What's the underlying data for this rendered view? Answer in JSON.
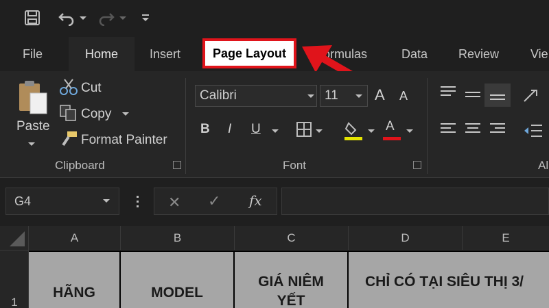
{
  "quick_access": {
    "icons": [
      "save-icon",
      "undo-icon",
      "redo-icon",
      "customize-icon"
    ]
  },
  "tabs": [
    {
      "label": "File"
    },
    {
      "label": "Home"
    },
    {
      "label": "Insert"
    },
    {
      "label": "Page Layout"
    },
    {
      "label": "Formulas"
    },
    {
      "label": "Data"
    },
    {
      "label": "Review"
    },
    {
      "label": "Vie"
    }
  ],
  "clipboard": {
    "paste_label": "Paste",
    "cut_label": "Cut",
    "copy_label": "Copy",
    "format_painter_label": "Format Painter",
    "group_label": "Clipboard"
  },
  "font": {
    "font_name": "Calibri",
    "font_size": "11",
    "grow_label": "A",
    "shrink_label": "A",
    "bold_label": "B",
    "italic_label": "I",
    "underline_label": "U",
    "font_color_label": "A",
    "group_label": "Font",
    "fill_color": "#e5e500",
    "font_color": "#e0141b"
  },
  "alignment": {
    "group_label_partial": "Al"
  },
  "formula_bar": {
    "name_box": "G4",
    "fx_label": "fx"
  },
  "grid": {
    "columns": [
      "A",
      "B",
      "C",
      "D",
      "E"
    ],
    "rows": [
      "1"
    ],
    "cells": [
      "HÃNG",
      "MODEL",
      "GIÁ NIÊM YẾT",
      "CHỈ CÓ TẠI SIÊU THỊ 3/"
    ]
  },
  "colors": {
    "highlight": "#e0141b",
    "background": "#1f1f1f",
    "ribbon": "#262626",
    "header_cell": "#a6a6a6"
  }
}
